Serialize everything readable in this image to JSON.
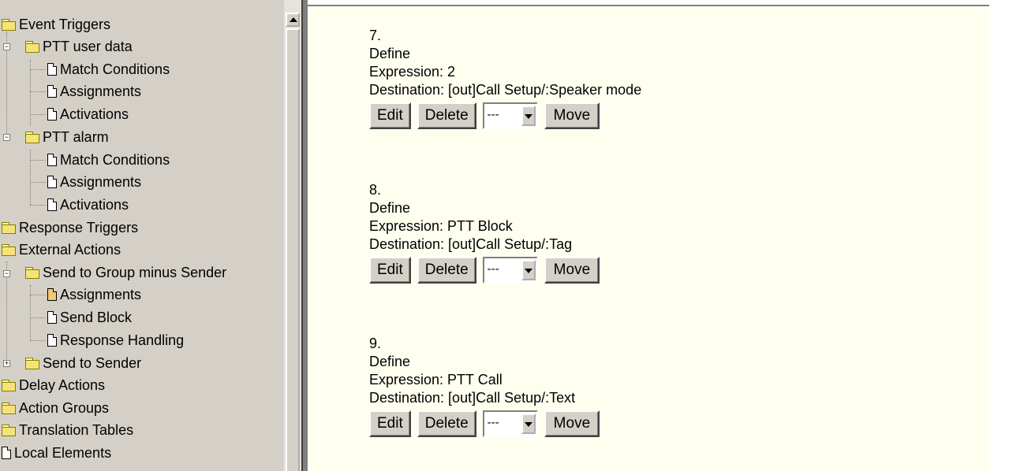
{
  "tree": {
    "items": [
      {
        "label": "Event Triggers",
        "icon": "folder-icon"
      },
      {
        "label": "PTT user data",
        "icon": "folder-icon"
      },
      {
        "label": "Match Conditions",
        "icon": "page-icon"
      },
      {
        "label": "Assignments",
        "icon": "page-icon"
      },
      {
        "label": "Activations",
        "icon": "page-icon"
      },
      {
        "label": "PTT alarm",
        "icon": "folder-icon"
      },
      {
        "label": "Match Conditions",
        "icon": "page-icon"
      },
      {
        "label": "Assignments",
        "icon": "page-icon"
      },
      {
        "label": "Activations",
        "icon": "page-icon"
      },
      {
        "label": "Response Triggers",
        "icon": "folder-icon"
      },
      {
        "label": "External Actions",
        "icon": "folder-icon"
      },
      {
        "label": "Send to Group minus Sender",
        "icon": "folder-icon"
      },
      {
        "label": "Assignments",
        "icon": "page-icon",
        "selected": true
      },
      {
        "label": "Send Block",
        "icon": "page-icon"
      },
      {
        "label": "Response Handling",
        "icon": "page-icon"
      },
      {
        "label": "Send to Sender",
        "icon": "folder-icon"
      },
      {
        "label": "Delay Actions",
        "icon": "folder-icon"
      },
      {
        "label": "Action Groups",
        "icon": "folder-icon"
      },
      {
        "label": "Translation Tables",
        "icon": "folder-icon"
      },
      {
        "label": "Local Elements",
        "icon": "page-icon"
      }
    ]
  },
  "entries": [
    {
      "number": "7.",
      "type": "Define",
      "expression": "Expression: 2",
      "destination": "Destination: [out]Call Setup/:Speaker mode"
    },
    {
      "number": "8.",
      "type": "Define",
      "expression": "Expression: PTT Block",
      "destination": "Destination: [out]Call Setup/:Tag"
    },
    {
      "number": "9.",
      "type": "Define",
      "expression": "Expression: PTT Call",
      "destination": "Destination: [out]Call Setup/:Text"
    }
  ],
  "buttons": {
    "edit": "Edit",
    "delete": "Delete",
    "move": "Move",
    "position_select": "---"
  }
}
